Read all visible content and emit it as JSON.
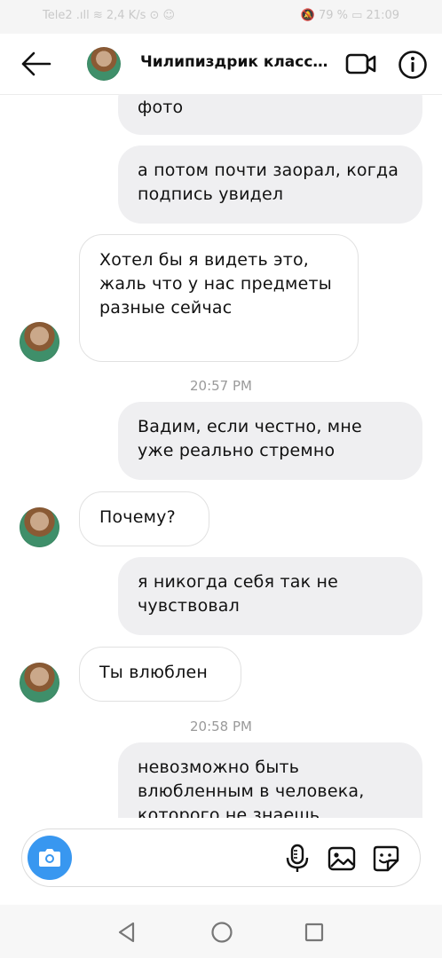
{
  "status_bar": {
    "left_text": "Tele2 .ıll ≋ 2,4 K/s ⊙ ☺",
    "right_text": "🔕 79 % ▭ 21:09"
  },
  "header": {
    "back_icon": "arrow-left-icon",
    "title": "Чилипиздрик класс…",
    "video_icon": "video-camera-icon",
    "info_icon": "info-icon"
  },
  "messages": [
    {
      "direction": "out",
      "text": "фото"
    },
    {
      "direction": "out",
      "text": "а потом почти заорал, когда подпись увидел"
    },
    {
      "direction": "in",
      "text": "Хотел бы я видеть это, жаль что у нас предметы разные сейчас"
    },
    {
      "timestamp": "20:57 PM"
    },
    {
      "direction": "out",
      "text": "Вадим, если честно, мне уже реально стремно"
    },
    {
      "direction": "in",
      "text": "Почему?"
    },
    {
      "direction": "out",
      "text": "я никогда себя так не чувствовал"
    },
    {
      "direction": "in",
      "text": "Ты влюблен"
    },
    {
      "timestamp": "20:58 PM"
    },
    {
      "direction": "out",
      "text": "невозможно быть влюбленным в человека, которого не знаешь"
    }
  ],
  "composer": {
    "camera_icon": "camera-icon",
    "mic_icon": "microphone-icon",
    "gallery_icon": "image-gallery-icon",
    "sticker_icon": "sticker-icon",
    "accent_color": "#3897f0"
  },
  "nav_bar": {
    "back_icon": "triangle-back-icon",
    "home_icon": "circle-home-icon",
    "recents_icon": "square-recents-icon"
  }
}
